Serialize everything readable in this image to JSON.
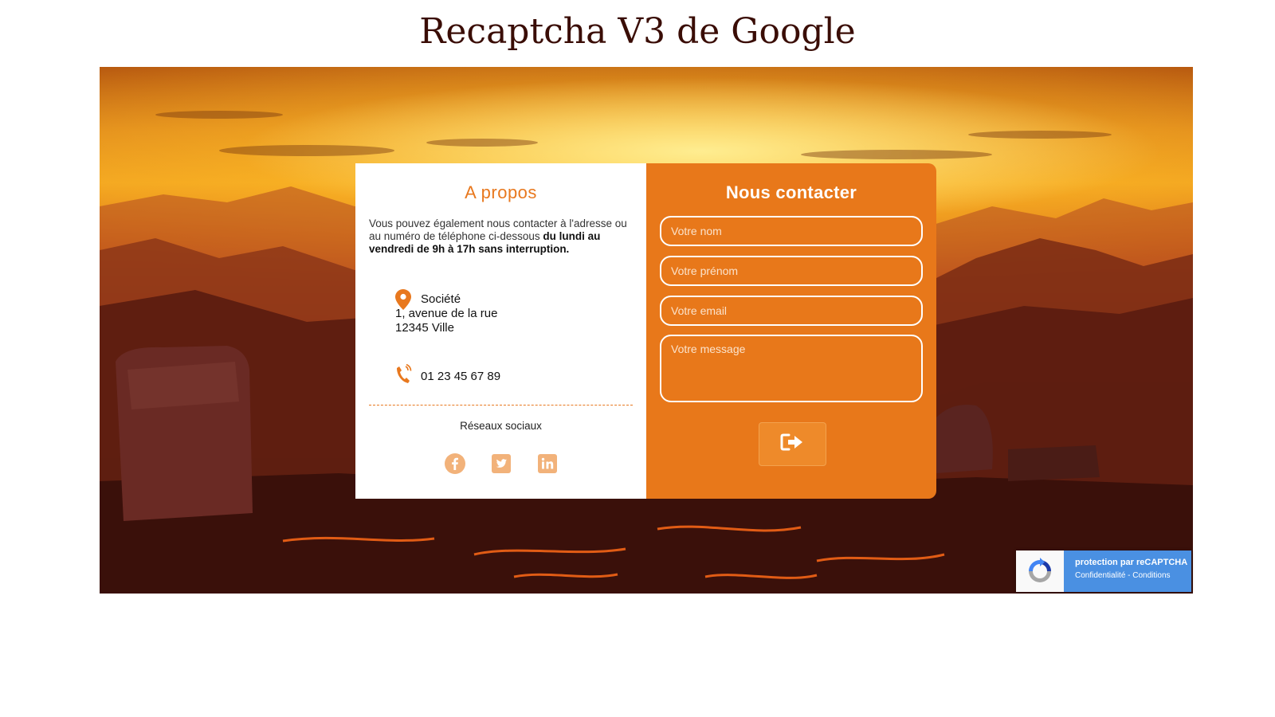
{
  "page": {
    "title": "Recaptcha V3 de Google"
  },
  "about": {
    "title": "A propos",
    "desc_plain": "Vous pouvez également nous contacter à l'adresse ou au numéro de téléphone ci-dessous ",
    "desc_bold": "du lundi au vendredi de 9h à 17h sans interruption.",
    "company": "Société",
    "street": "1, avenue de la rue",
    "city": "12345 Ville",
    "phone": "01 23 45 67 89",
    "social_label": "Réseaux sociaux",
    "social_icons": [
      "facebook-icon",
      "twitter-icon",
      "linkedin-icon"
    ]
  },
  "contact": {
    "title": "Nous contacter",
    "name_placeholder": "Votre nom",
    "firstname_placeholder": "Votre prénom",
    "email_placeholder": "Votre email",
    "message_placeholder": "Votre message",
    "submit_icon": "sign-out-icon"
  },
  "recaptcha": {
    "line1": "protection par reCAPTCHA",
    "privacy": "Confidentialité",
    "separator": " - ",
    "terms": "Conditions"
  },
  "colors": {
    "accent": "#e8781a",
    "title": "#3a0d06",
    "recaptcha_blue": "#4a90e2"
  }
}
